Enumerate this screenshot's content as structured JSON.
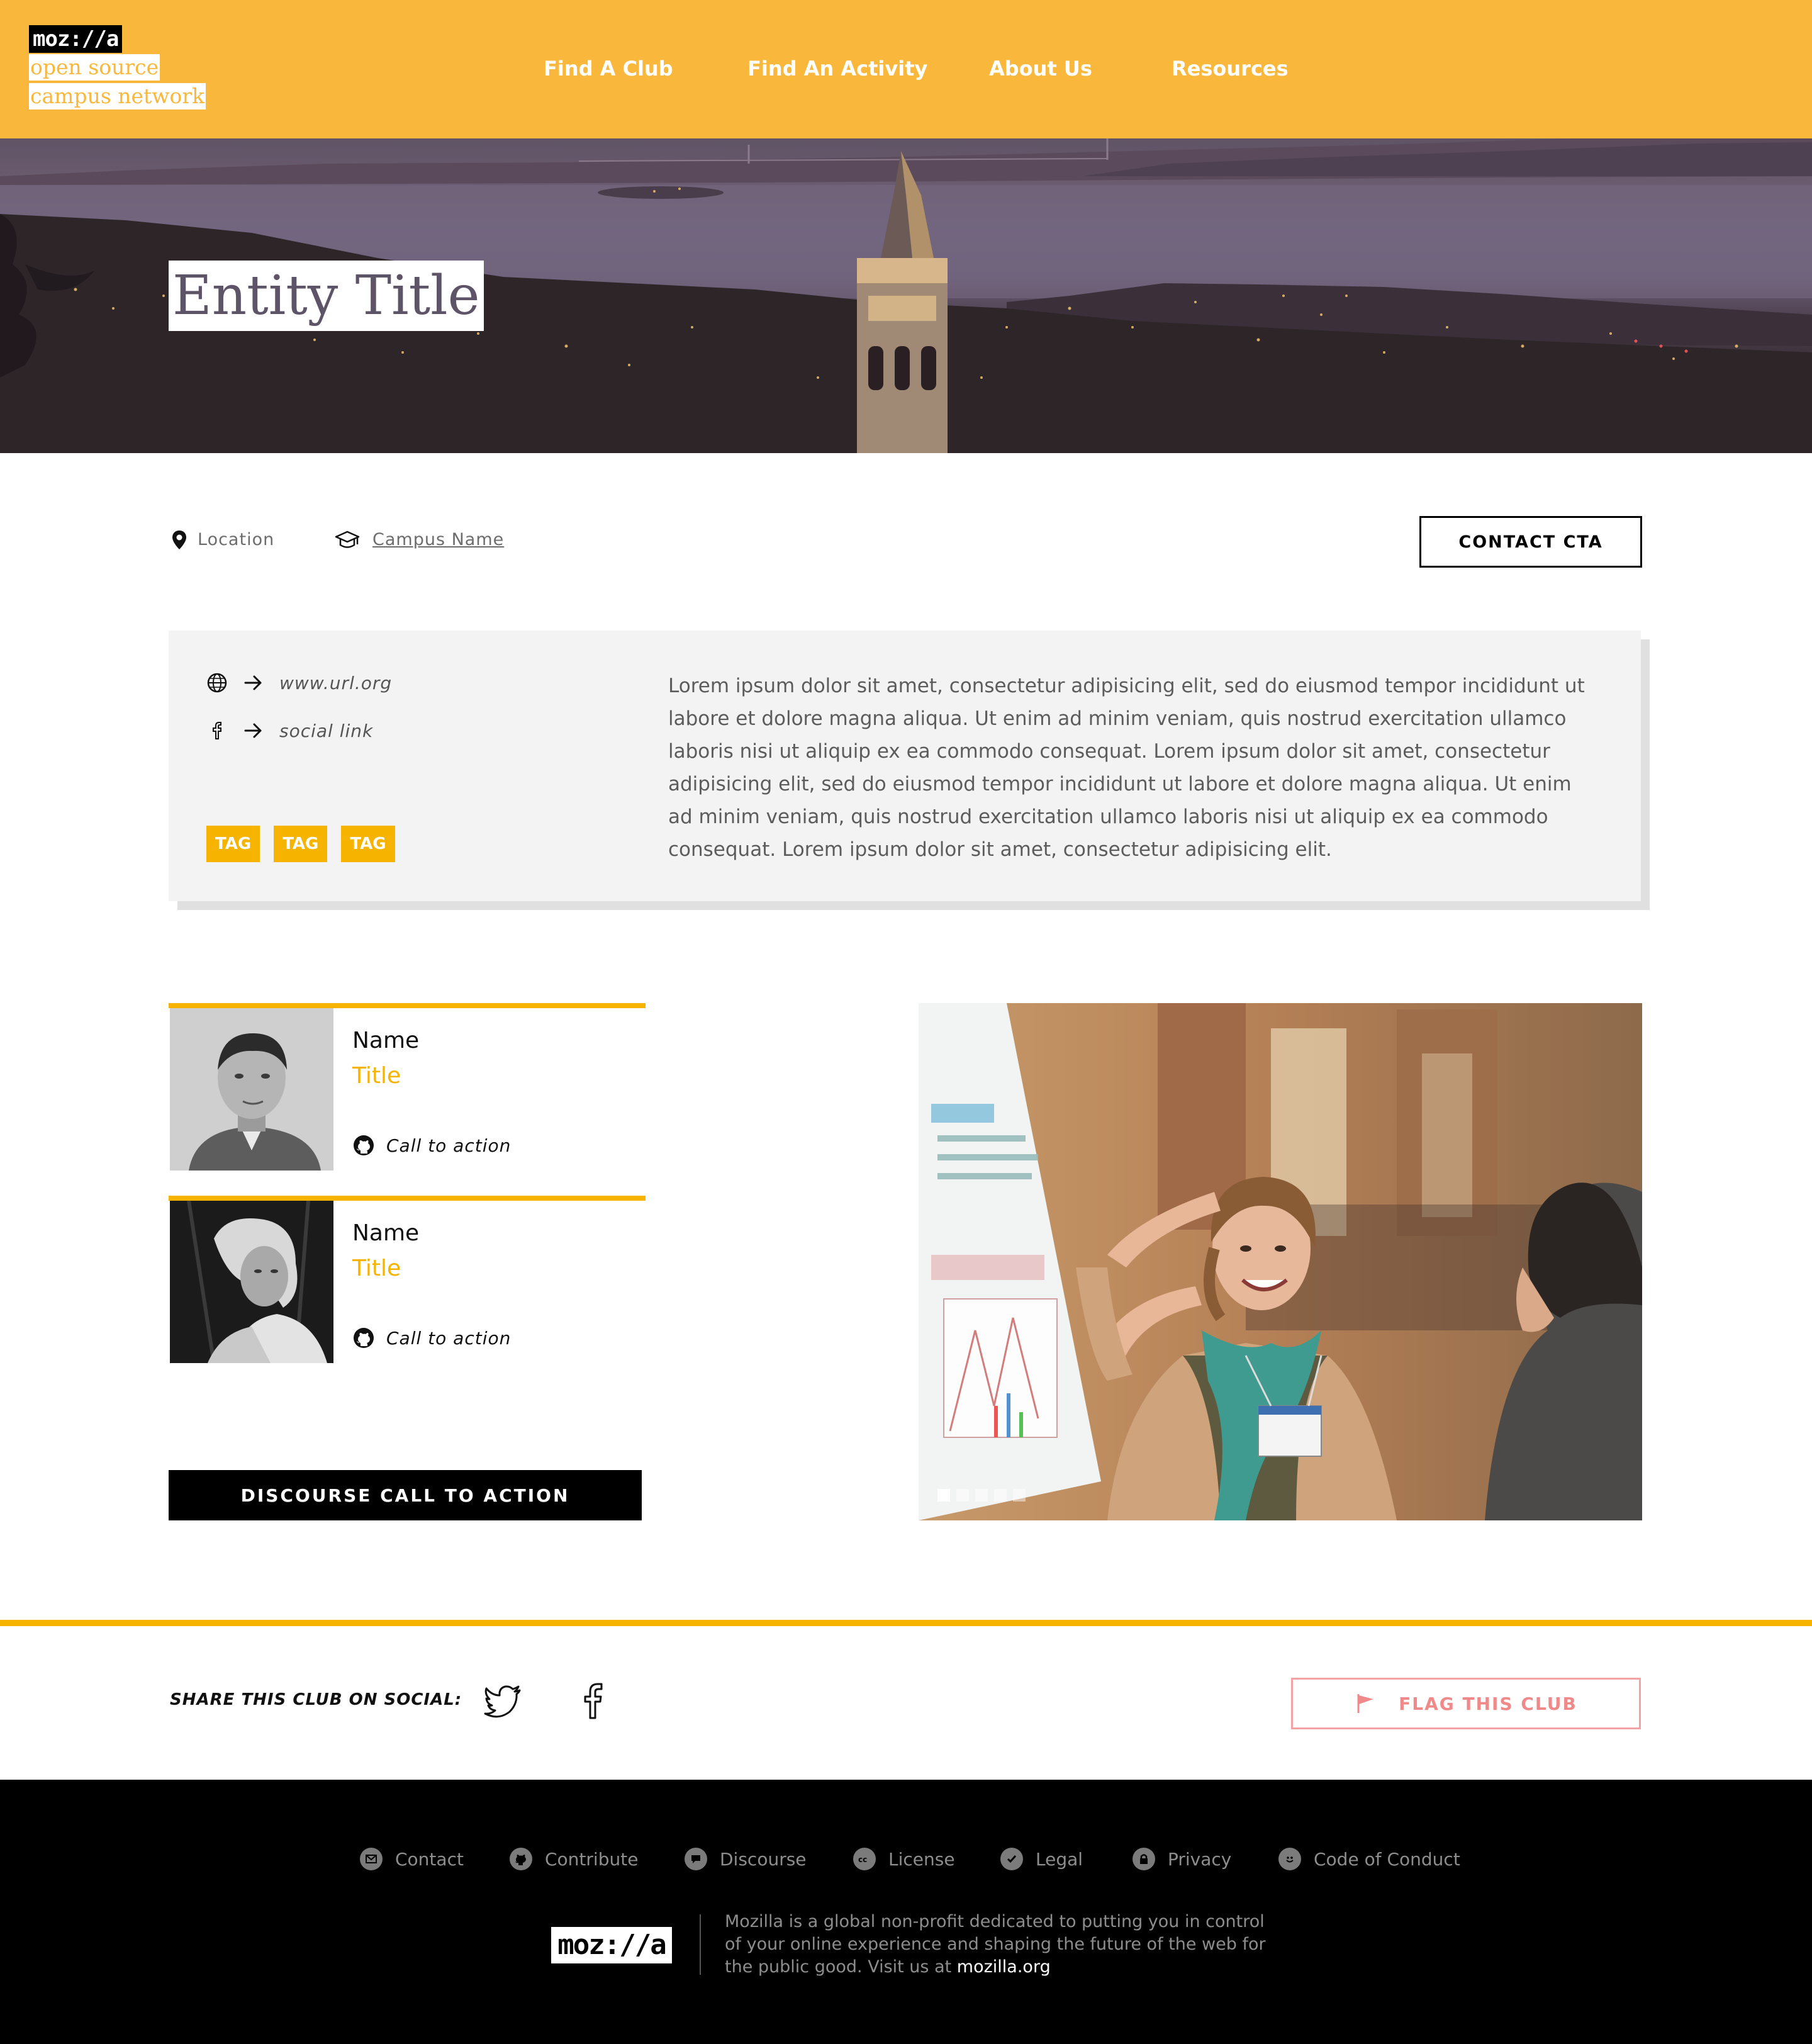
{
  "header": {
    "logo": {
      "wordmark": "moz://a",
      "line1": "open source",
      "line2": "campus network"
    },
    "nav": [
      {
        "label": "Find A Club"
      },
      {
        "label": "Find An Activity"
      },
      {
        "label": "About Us"
      },
      {
        "label": "Resources"
      }
    ]
  },
  "hero": {
    "title": "Entity Title"
  },
  "meta": {
    "location": "Location",
    "campus": "Campus Name",
    "contact_cta": "CONTACT CTA"
  },
  "info": {
    "links": [
      {
        "icon": "globe-icon",
        "text": "www.url.org"
      },
      {
        "icon": "facebook-icon",
        "text": "social link"
      }
    ],
    "tags": [
      "TAG",
      "TAG",
      "TAG"
    ],
    "description": "Lorem ipsum dolor sit amet, consectetur adipisicing elit, sed do eiusmod tempor incididunt ut labore et dolore magna aliqua. Ut enim ad minim veniam, quis nostrud exercitation ullamco laboris nisi ut aliquip ex ea commodo consequat. Lorem ipsum dolor sit amet, consectetur adipisicing elit, sed do eiusmod tempor incididunt ut labore et dolore magna aliqua. Ut enim ad minim veniam, quis nostrud exercitation ullamco laboris nisi ut aliquip ex ea commodo consequat. Lorem ipsum dolor sit amet, consectetur adipisicing elit."
  },
  "people": [
    {
      "name": "Name",
      "title": "Title",
      "cta": "Call to action"
    },
    {
      "name": "Name",
      "title": "Title",
      "cta": "Call to action"
    }
  ],
  "discourse_cta": "DISCOURSE CALL TO ACTION",
  "gallery": {
    "slide_count": 5,
    "active_index": 0
  },
  "share": {
    "label": "SHARE THIS CLUB ON SOCIAL:",
    "flag_label": "FLAG THIS CLUB"
  },
  "footer": {
    "links": [
      {
        "label": "Contact",
        "icon": "envelope-icon"
      },
      {
        "label": "Contribute",
        "icon": "github-icon"
      },
      {
        "label": "Discourse",
        "icon": "chat-bubble-icon"
      },
      {
        "label": "License",
        "icon": "creative-commons-icon"
      },
      {
        "label": "Legal",
        "icon": "checkmark-icon"
      },
      {
        "label": "Privacy",
        "icon": "lock-icon"
      },
      {
        "label": "Code of Conduct",
        "icon": "smiley-icon"
      }
    ],
    "logo": "moz://a",
    "about_text": "Mozilla is a global non-profit dedicated to putting you in control of your online experience and shaping the future of the web for the public good. Visit us at",
    "about_link": "mozilla.org"
  },
  "colors": {
    "brand_yellow": "#f9b83c",
    "tag_yellow": "#f6b400",
    "flag_red": "#f08a8a",
    "footer_bg": "#000000"
  }
}
